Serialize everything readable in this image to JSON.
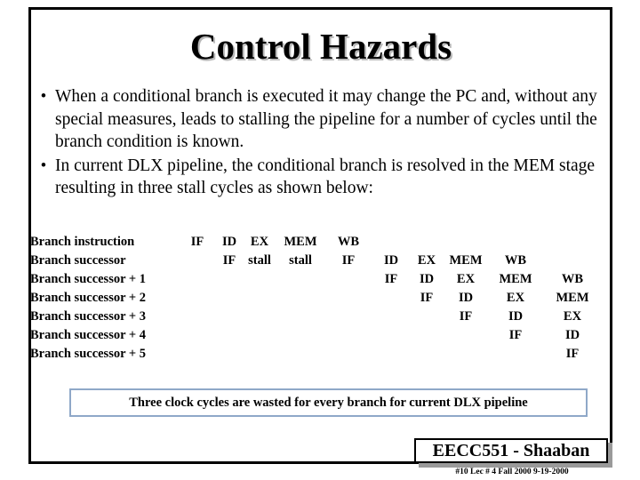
{
  "slide": {
    "title": "Control Hazards",
    "bullet_marker": "•",
    "bullets": [
      "When a conditional branch is executed it may change the PC and, without any special measures, leads to stalling the pipeline for a number of cycles until the branch condition is known.",
      "In current DLX pipeline, the conditional branch  is resolved in the MEM stage resulting in three stall cycles as shown below:"
    ]
  },
  "pipeline": {
    "column_x": [
      222,
      258,
      292,
      338,
      392,
      440,
      480,
      524,
      580,
      644
    ],
    "rows": [
      {
        "label": "Branch instruction",
        "stages": [
          {
            "text": "IF",
            "col": 0
          },
          {
            "text": "ID",
            "col": 1
          },
          {
            "text": "EX",
            "col": 2
          },
          {
            "text": "MEM",
            "col": 3
          },
          {
            "text": "WB",
            "col": 4
          }
        ]
      },
      {
        "label": "Branch successor",
        "stages": [
          {
            "text": "IF",
            "col": 1
          },
          {
            "text": "stall",
            "col": 2
          },
          {
            "text": "stall",
            "col": 3
          },
          {
            "text": "IF",
            "col": 4
          },
          {
            "text": "ID",
            "col": 5
          },
          {
            "text": "EX",
            "col": 6
          },
          {
            "text": "MEM",
            "col": 7
          },
          {
            "text": "WB",
            "col": 8
          }
        ]
      },
      {
        "label": "Branch successor + 1",
        "stages": [
          {
            "text": "IF",
            "col": 5
          },
          {
            "text": "ID",
            "col": 6
          },
          {
            "text": "EX",
            "col": 7
          },
          {
            "text": "MEM",
            "col": 8
          },
          {
            "text": "WB",
            "col": 9
          }
        ]
      },
      {
        "label": "Branch successor + 2",
        "stages": [
          {
            "text": "IF",
            "col": 6
          },
          {
            "text": "ID",
            "col": 7
          },
          {
            "text": "EX",
            "col": 8
          },
          {
            "text": "MEM",
            "col": 9
          }
        ]
      },
      {
        "label": "Branch successor + 3",
        "stages": [
          {
            "text": "IF",
            "col": 7
          },
          {
            "text": "ID",
            "col": 8
          },
          {
            "text": "EX",
            "col": 9
          }
        ]
      },
      {
        "label": "Branch successor + 4",
        "stages": [
          {
            "text": "IF",
            "col": 8
          },
          {
            "text": "ID",
            "col": 9
          }
        ]
      },
      {
        "label": "Branch successor + 5",
        "stages": [
          {
            "text": "IF",
            "col": 9
          }
        ]
      }
    ]
  },
  "callout": {
    "text": "Three clock cycles are wasted for every branch for current DLX pipeline",
    "border_color": "#8fa8c8"
  },
  "footer": {
    "course": "EECC551 - Shaaban",
    "meta": "#10   Lec # 4   Fall 2000  9-19-2000"
  }
}
